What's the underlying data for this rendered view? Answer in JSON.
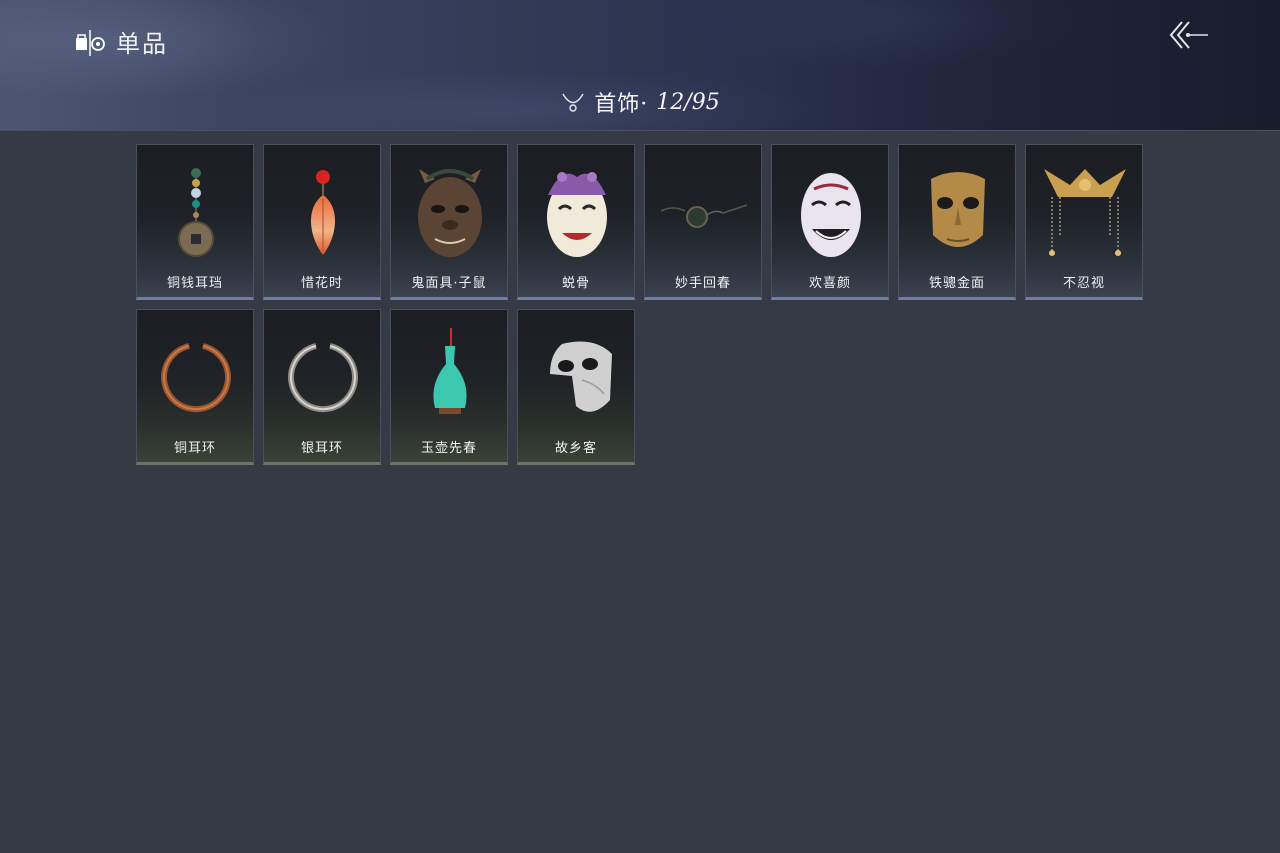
{
  "header": {
    "title": "单品",
    "title_icon": "wardrobe-icon",
    "back_icon": "back-arrow-icon"
  },
  "category": {
    "icon": "necklace-icon",
    "label": "首饰·",
    "count": "12/95"
  },
  "items": [
    {
      "name": "铜钱耳珰",
      "icon": "coin-earring"
    },
    {
      "name": "惜花时",
      "icon": "petal-earring"
    },
    {
      "name": "鬼面具·子鼠",
      "icon": "rat-mask"
    },
    {
      "name": "蜕骨",
      "icon": "jester-mask"
    },
    {
      "name": "妙手回春",
      "icon": "glasses"
    },
    {
      "name": "欢喜颜",
      "icon": "smiling-mask"
    },
    {
      "name": "铁骢金面",
      "icon": "gold-mask"
    },
    {
      "name": "不忍视",
      "icon": "gold-headdress"
    },
    {
      "name": "铜耳环",
      "icon": "copper-ring"
    },
    {
      "name": "银耳环",
      "icon": "silver-ring"
    },
    {
      "name": "玉壶先春",
      "icon": "jade-vase"
    },
    {
      "name": "故乡客",
      "icon": "half-mask"
    }
  ],
  "colors": {
    "background": "#353a44",
    "row1_accent": "#6b7fa6",
    "row2_accent": "#6c7569"
  }
}
